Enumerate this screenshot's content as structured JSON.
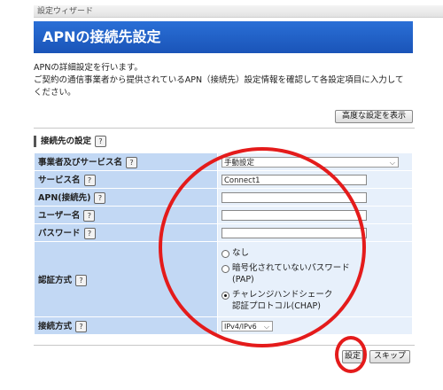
{
  "wizard": {
    "label": "設定ウィザード"
  },
  "page": {
    "title": "APNの接続先設定"
  },
  "description": {
    "line1": "APNの詳細設定を行います。",
    "line2": "ご契約の通信事業者から提供されているAPN（接続先）設定情報を確認して各設定項目に入力して",
    "line3": "ください。"
  },
  "advanced_button": "高度な設定を表示",
  "section": {
    "title": "接続先の設定"
  },
  "help_glyph": "?",
  "form": {
    "carrier": {
      "label": "事業者及びサービス名",
      "value": "手動設定"
    },
    "service_name": {
      "label": "サービス名",
      "value": "Connect1"
    },
    "apn": {
      "label": "APN(接続先)",
      "value": ""
    },
    "username": {
      "label": "ユーザー名",
      "value": ""
    },
    "password": {
      "label": "パスワード",
      "value": ""
    },
    "auth": {
      "label": "認証方式",
      "options": [
        {
          "label": "なし",
          "selected": false
        },
        {
          "label": "暗号化されていないパスワード",
          "sub": "(PAP)",
          "selected": false
        },
        {
          "label": "チャレンジハンドシェーク",
          "sub": "認証プロトコル(CHAP)",
          "selected": true
        }
      ]
    },
    "connection": {
      "label": "接続方式",
      "value": "IPv4/IPv6"
    }
  },
  "buttons": {
    "set": "設定",
    "skip": "スキップ"
  },
  "annotation": {
    "color": "#e41b1b"
  },
  "icons": {
    "dropdown": "chevron-down-icon",
    "help": "help-icon"
  }
}
